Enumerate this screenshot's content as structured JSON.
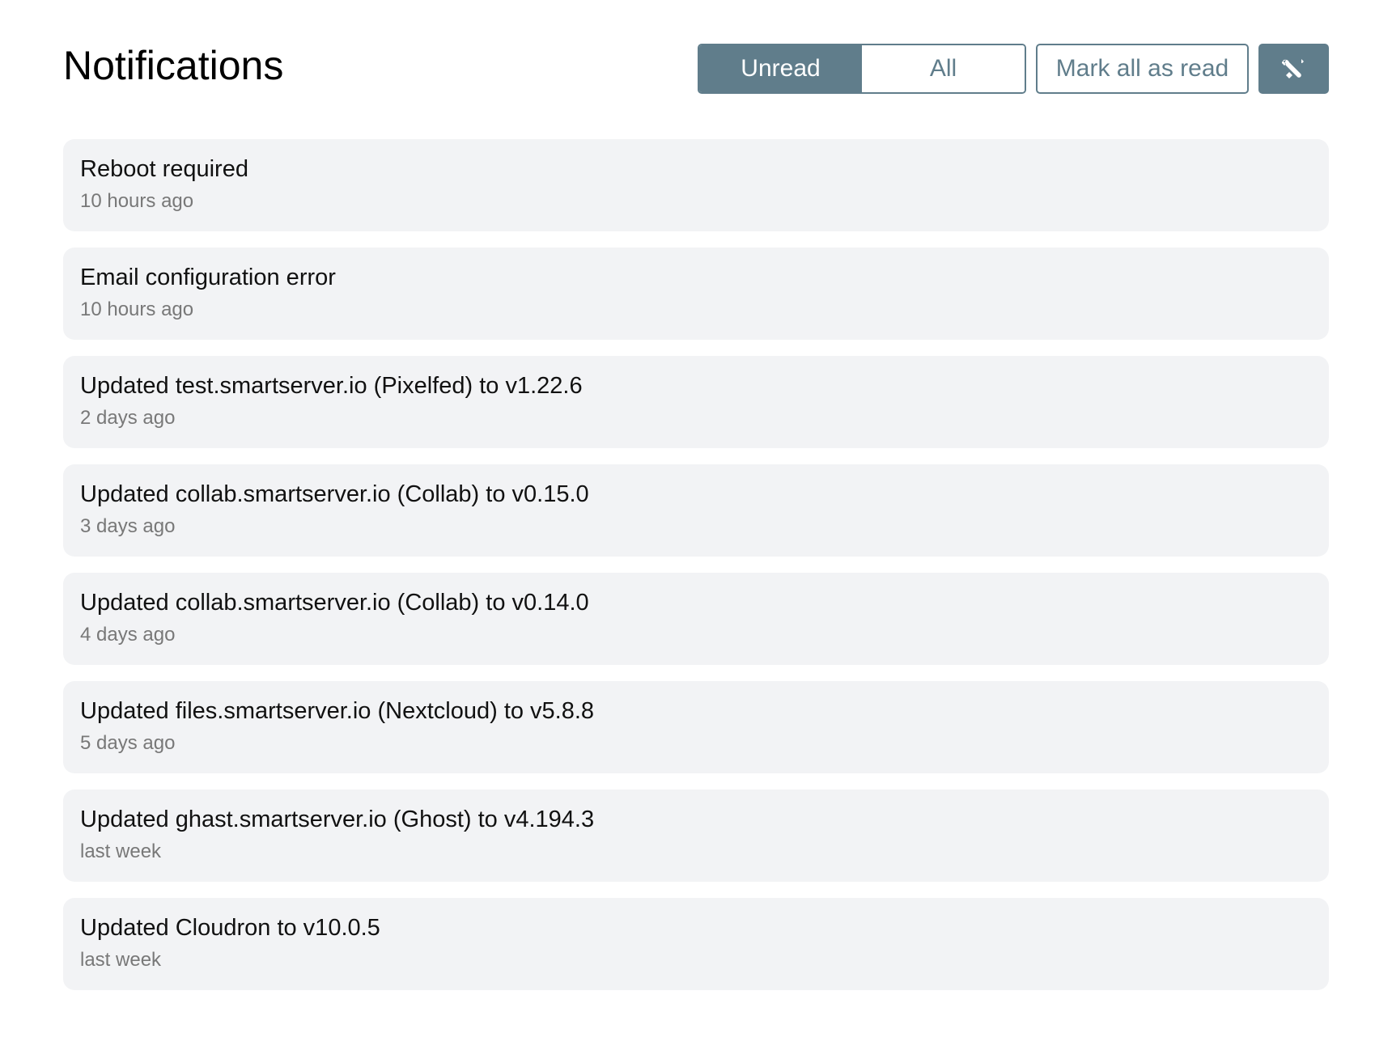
{
  "page": {
    "title": "Notifications"
  },
  "toolbar": {
    "filter_options": [
      {
        "label": "Unread",
        "selected": true
      },
      {
        "label": "All",
        "selected": false
      }
    ],
    "mark_all_label": "Mark all as read",
    "settings_icon": "tools-icon"
  },
  "colors": {
    "accent": "#607d8b",
    "card_background": "#f2f3f5",
    "secondary_text": "#787878"
  },
  "notifications": [
    {
      "title": "Reboot required",
      "time": "10 hours ago"
    },
    {
      "title": "Email configuration error",
      "time": "10 hours ago"
    },
    {
      "title": "Updated test.smartserver.io (Pixelfed) to v1.22.6",
      "time": "2 days ago"
    },
    {
      "title": "Updated collab.smartserver.io (Collab) to v0.15.0",
      "time": "3 days ago"
    },
    {
      "title": "Updated collab.smartserver.io (Collab) to v0.14.0",
      "time": "4 days ago"
    },
    {
      "title": "Updated files.smartserver.io (Nextcloud) to v5.8.8",
      "time": "5 days ago"
    },
    {
      "title": "Updated ghast.smartserver.io (Ghost) to v4.194.3",
      "time": "last week"
    },
    {
      "title": "Updated Cloudron to v10.0.5",
      "time": "last week"
    }
  ]
}
